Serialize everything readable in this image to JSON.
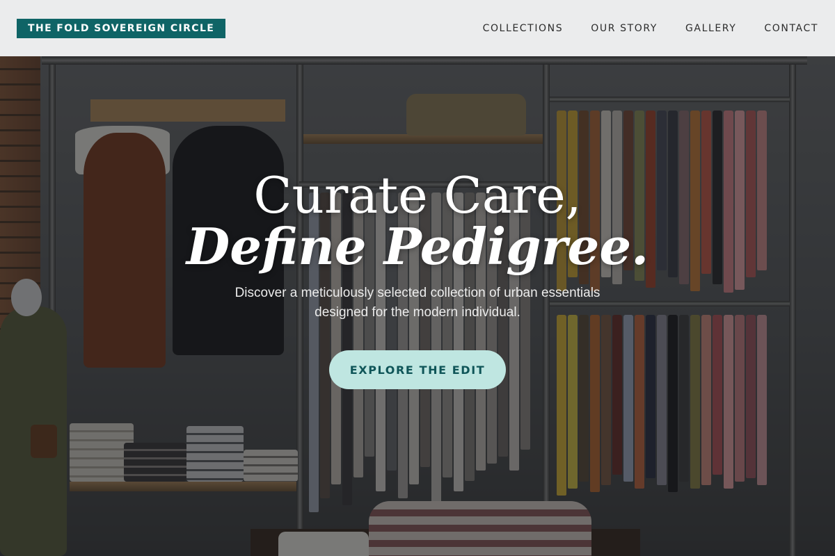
{
  "header": {
    "brand": "THE FOLD SOVEREIGN CIRCLE",
    "nav": [
      "COLLECTIONS",
      "OUR STORY",
      "GALLERY",
      "CONTACT"
    ]
  },
  "hero": {
    "headline_line1": "Curate Care,",
    "headline_line2": "Define Pedigree.",
    "subtitle": "Discover a meticulously selected collection of urban essentials designed for the modern individual.",
    "cta_label": "EXPLORE THE EDIT",
    "background_image": "clothing-store-interior"
  },
  "colors": {
    "brand_teal": "#0f6466",
    "cta_background": "#bfe6e1",
    "cta_text": "#0f5558",
    "header_background": "#f4f4f5"
  }
}
